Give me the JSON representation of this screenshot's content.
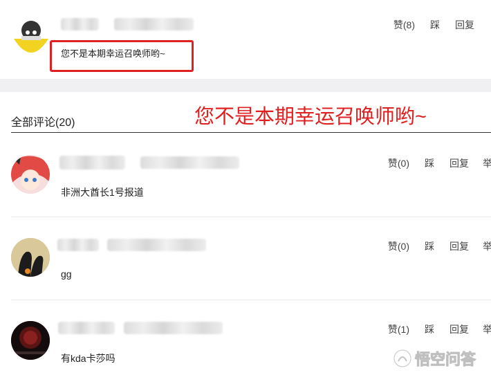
{
  "top_comment": {
    "text": "您不是本期幸运召唤师哟~",
    "actions": {
      "like": "赞(8)",
      "dislike": "踩",
      "reply": "回复"
    }
  },
  "annotation": {
    "text": "您不是本期幸运召唤师哟~",
    "color": "#e02020"
  },
  "comments_header": {
    "label": "全部评论(20)"
  },
  "comments": [
    {
      "text": "非洲大酋长1号报道",
      "like": "赞(0)",
      "dislike": "踩",
      "reply": "回复",
      "report": "举"
    },
    {
      "text": "gg",
      "like": "赞(0)",
      "dislike": "踩",
      "reply": "回复",
      "report": "举"
    },
    {
      "text": "有kda卡莎吗",
      "like": "赞(1)",
      "dislike": "踩",
      "reply": "回复",
      "report": "举"
    }
  ],
  "watermark": {
    "text": "悟空问答"
  }
}
